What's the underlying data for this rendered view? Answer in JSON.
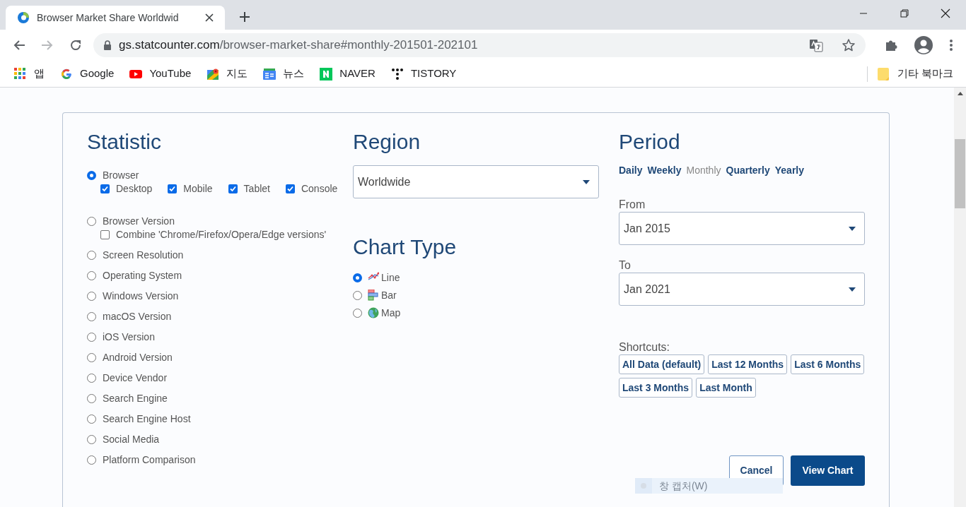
{
  "browser": {
    "tab_title": "Browser Market Share Worldwid",
    "address": {
      "host": "gs.statcounter.com",
      "path": "/browser-market-share#monthly-201501-202101"
    },
    "bookmarks": [
      {
        "kind": "apps",
        "label": "앱"
      },
      {
        "kind": "google",
        "label": "Google"
      },
      {
        "kind": "youtube",
        "label": "YouTube"
      },
      {
        "kind": "maps",
        "label": "지도"
      },
      {
        "kind": "news",
        "label": "뉴스"
      },
      {
        "kind": "naver",
        "label": "NAVER"
      },
      {
        "kind": "tistory",
        "label": "TISTORY"
      }
    ],
    "other_bookmarks": "기타 북마크"
  },
  "statistic": {
    "title": "Statistic",
    "options": [
      {
        "label": "Browser",
        "selected": true,
        "sub_options": [
          {
            "label": "Desktop",
            "checked": true
          },
          {
            "label": "Mobile",
            "checked": true
          },
          {
            "label": "Tablet",
            "checked": true
          },
          {
            "label": "Console",
            "checked": true
          }
        ]
      },
      {
        "label": "Browser Version",
        "selected": false,
        "sub_options": [
          {
            "label": "Combine 'Chrome/Firefox/Opera/Edge versions'",
            "checked": false
          }
        ]
      },
      {
        "label": "Screen Resolution",
        "selected": false
      },
      {
        "label": "Operating System",
        "selected": false
      },
      {
        "label": "Windows Version",
        "selected": false
      },
      {
        "label": "macOS Version",
        "selected": false
      },
      {
        "label": "iOS Version",
        "selected": false
      },
      {
        "label": "Android Version",
        "selected": false
      },
      {
        "label": "Device Vendor",
        "selected": false
      },
      {
        "label": "Search Engine",
        "selected": false
      },
      {
        "label": "Search Engine Host",
        "selected": false
      },
      {
        "label": "Social Media",
        "selected": false
      },
      {
        "label": "Platform Comparison",
        "selected": false
      }
    ]
  },
  "region": {
    "title": "Region",
    "value": "Worldwide"
  },
  "chart_type": {
    "title": "Chart Type",
    "options": [
      {
        "kind": "line",
        "label": "Line",
        "selected": true
      },
      {
        "kind": "bar",
        "label": "Bar",
        "selected": false
      },
      {
        "kind": "map",
        "label": "Map",
        "selected": false
      }
    ]
  },
  "period": {
    "title": "Period",
    "intervals": [
      {
        "label": "Daily",
        "selected": false
      },
      {
        "label": "Weekly",
        "selected": false
      },
      {
        "label": "Monthly",
        "selected": true
      },
      {
        "label": "Quarterly",
        "selected": false
      },
      {
        "label": "Yearly",
        "selected": false
      }
    ],
    "from": {
      "label": "From",
      "value": "Jan 2015"
    },
    "to": {
      "label": "To",
      "value": "Jan 2021"
    },
    "shortcuts_label": "Shortcuts:",
    "shortcuts": [
      "All Data (default)",
      "Last 12 Months",
      "Last 6 Months",
      "Last 3 Months",
      "Last Month"
    ]
  },
  "actions": {
    "cancel": "Cancel",
    "submit": "View Chart"
  },
  "capture_tooltip": "창 캡처(W)"
}
